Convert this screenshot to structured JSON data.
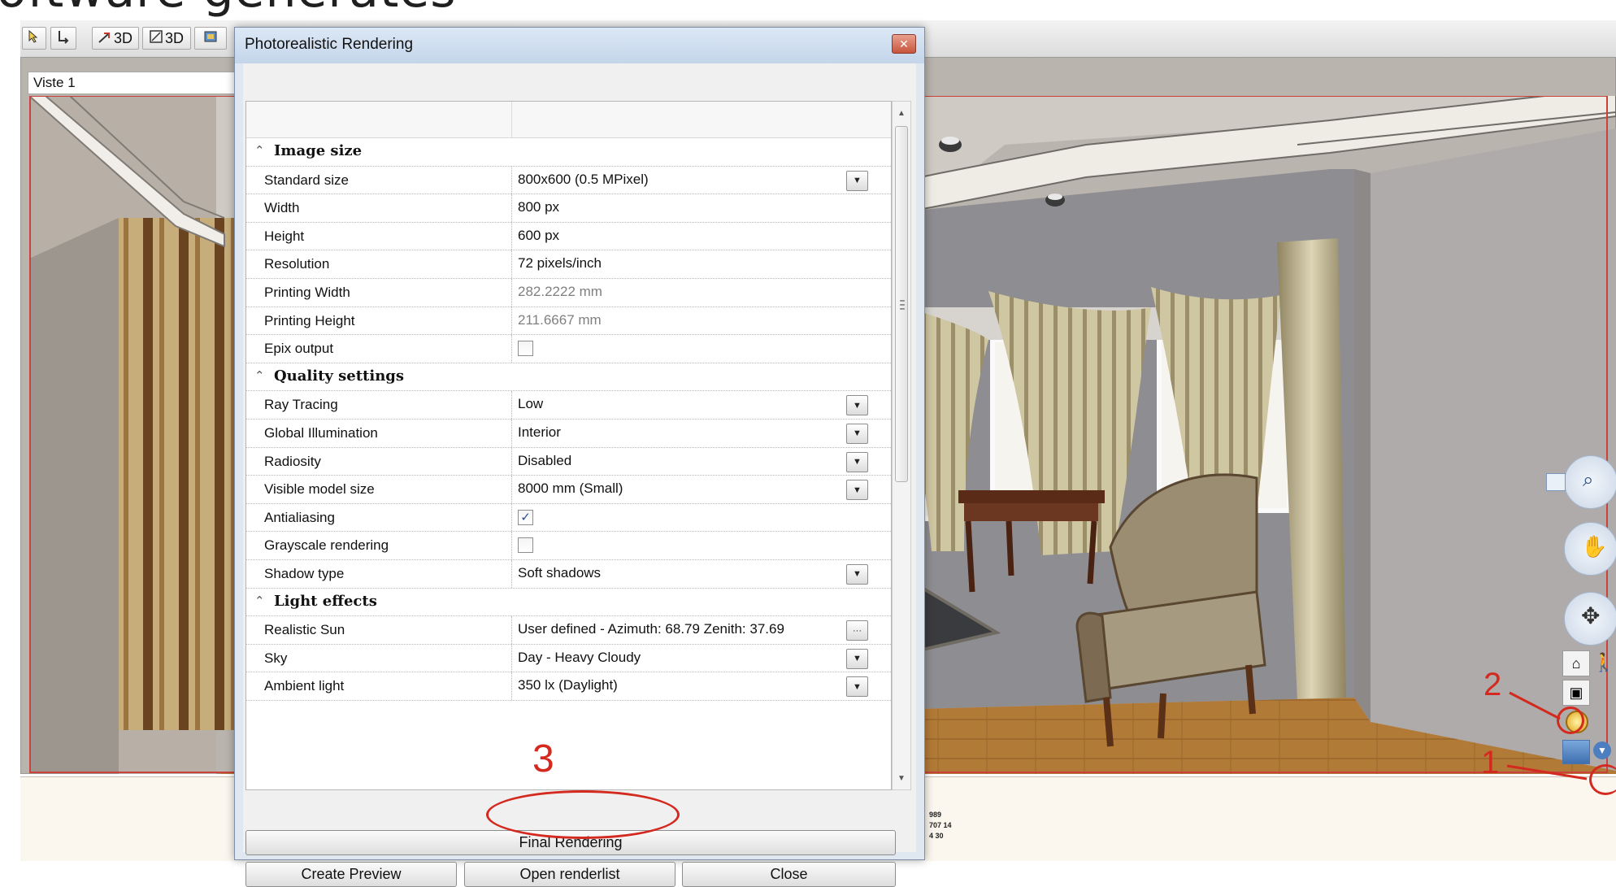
{
  "slide": {
    "title_fragment": "oftware generates"
  },
  "toolbar": {
    "buttons": [
      {
        "label": "",
        "icon": "select-arrow-icon"
      },
      {
        "label": "",
        "icon": "elevation-icon"
      },
      {
        "label": "3D",
        "icon": "3d-arrow-icon"
      },
      {
        "label": "3D",
        "icon": "3d-box-icon"
      }
    ]
  },
  "view": {
    "tab_label": "Viste 1"
  },
  "dialog": {
    "title": "Photorealistic Rendering",
    "sections": [
      {
        "title": "Image size",
        "rows": [
          {
            "name": "Standard size",
            "value": "800x600   (0.5 MPixel)",
            "control": "dropdown"
          },
          {
            "name": "Width",
            "value": "800 px",
            "control": "text"
          },
          {
            "name": "Height",
            "value": "600 px",
            "control": "text"
          },
          {
            "name": "Resolution",
            "value": "72 pixels/inch",
            "control": "text"
          },
          {
            "name": "Printing Width",
            "value": "282.2222 mm",
            "control": "readonly"
          },
          {
            "name": "Printing Height",
            "value": "211.6667 mm",
            "control": "readonly"
          },
          {
            "name": "Epix output",
            "value": "",
            "checked": false,
            "control": "checkbox"
          }
        ]
      },
      {
        "title": "Quality settings",
        "rows": [
          {
            "name": "Ray Tracing",
            "value": "Low",
            "control": "dropdown"
          },
          {
            "name": "Global Illumination",
            "value": "Interior",
            "control": "dropdown"
          },
          {
            "name": "Radiosity",
            "value": "Disabled",
            "control": "dropdown"
          },
          {
            "name": "Visible model size",
            "value": "8000 mm (Small)",
            "control": "dropdown"
          },
          {
            "name": "Antialiasing",
            "value": "",
            "checked": true,
            "control": "checkbox"
          },
          {
            "name": "Grayscale rendering",
            "value": "",
            "checked": false,
            "control": "checkbox"
          },
          {
            "name": "Shadow type",
            "value": "Soft shadows",
            "control": "dropdown"
          }
        ]
      },
      {
        "title": "Light effects",
        "rows": [
          {
            "name": "Realistic Sun",
            "value": "User defined - Azimuth: 68.79 Zenith: 37.69",
            "control": "ellipsis"
          },
          {
            "name": "Sky",
            "value": "Day - Heavy Cloudy",
            "control": "dropdown"
          },
          {
            "name": "Ambient light",
            "value": "350 lx (Daylight)",
            "control": "dropdown"
          }
        ]
      }
    ],
    "buttons": {
      "final_rendering": "Final Rendering",
      "create_preview": "Create Preview",
      "open_renderlist": "Open renderlist",
      "close": "Close"
    }
  },
  "annotations": {
    "one": "1",
    "two": "2",
    "three": "3"
  },
  "plan_panel": {
    "labels": [
      "989",
      "707 14",
      "4  30"
    ]
  },
  "colors": {
    "annotation_red": "#d3291f",
    "dialog_frame": "#dfe7f1",
    "floor_wood": "#a9702e"
  }
}
